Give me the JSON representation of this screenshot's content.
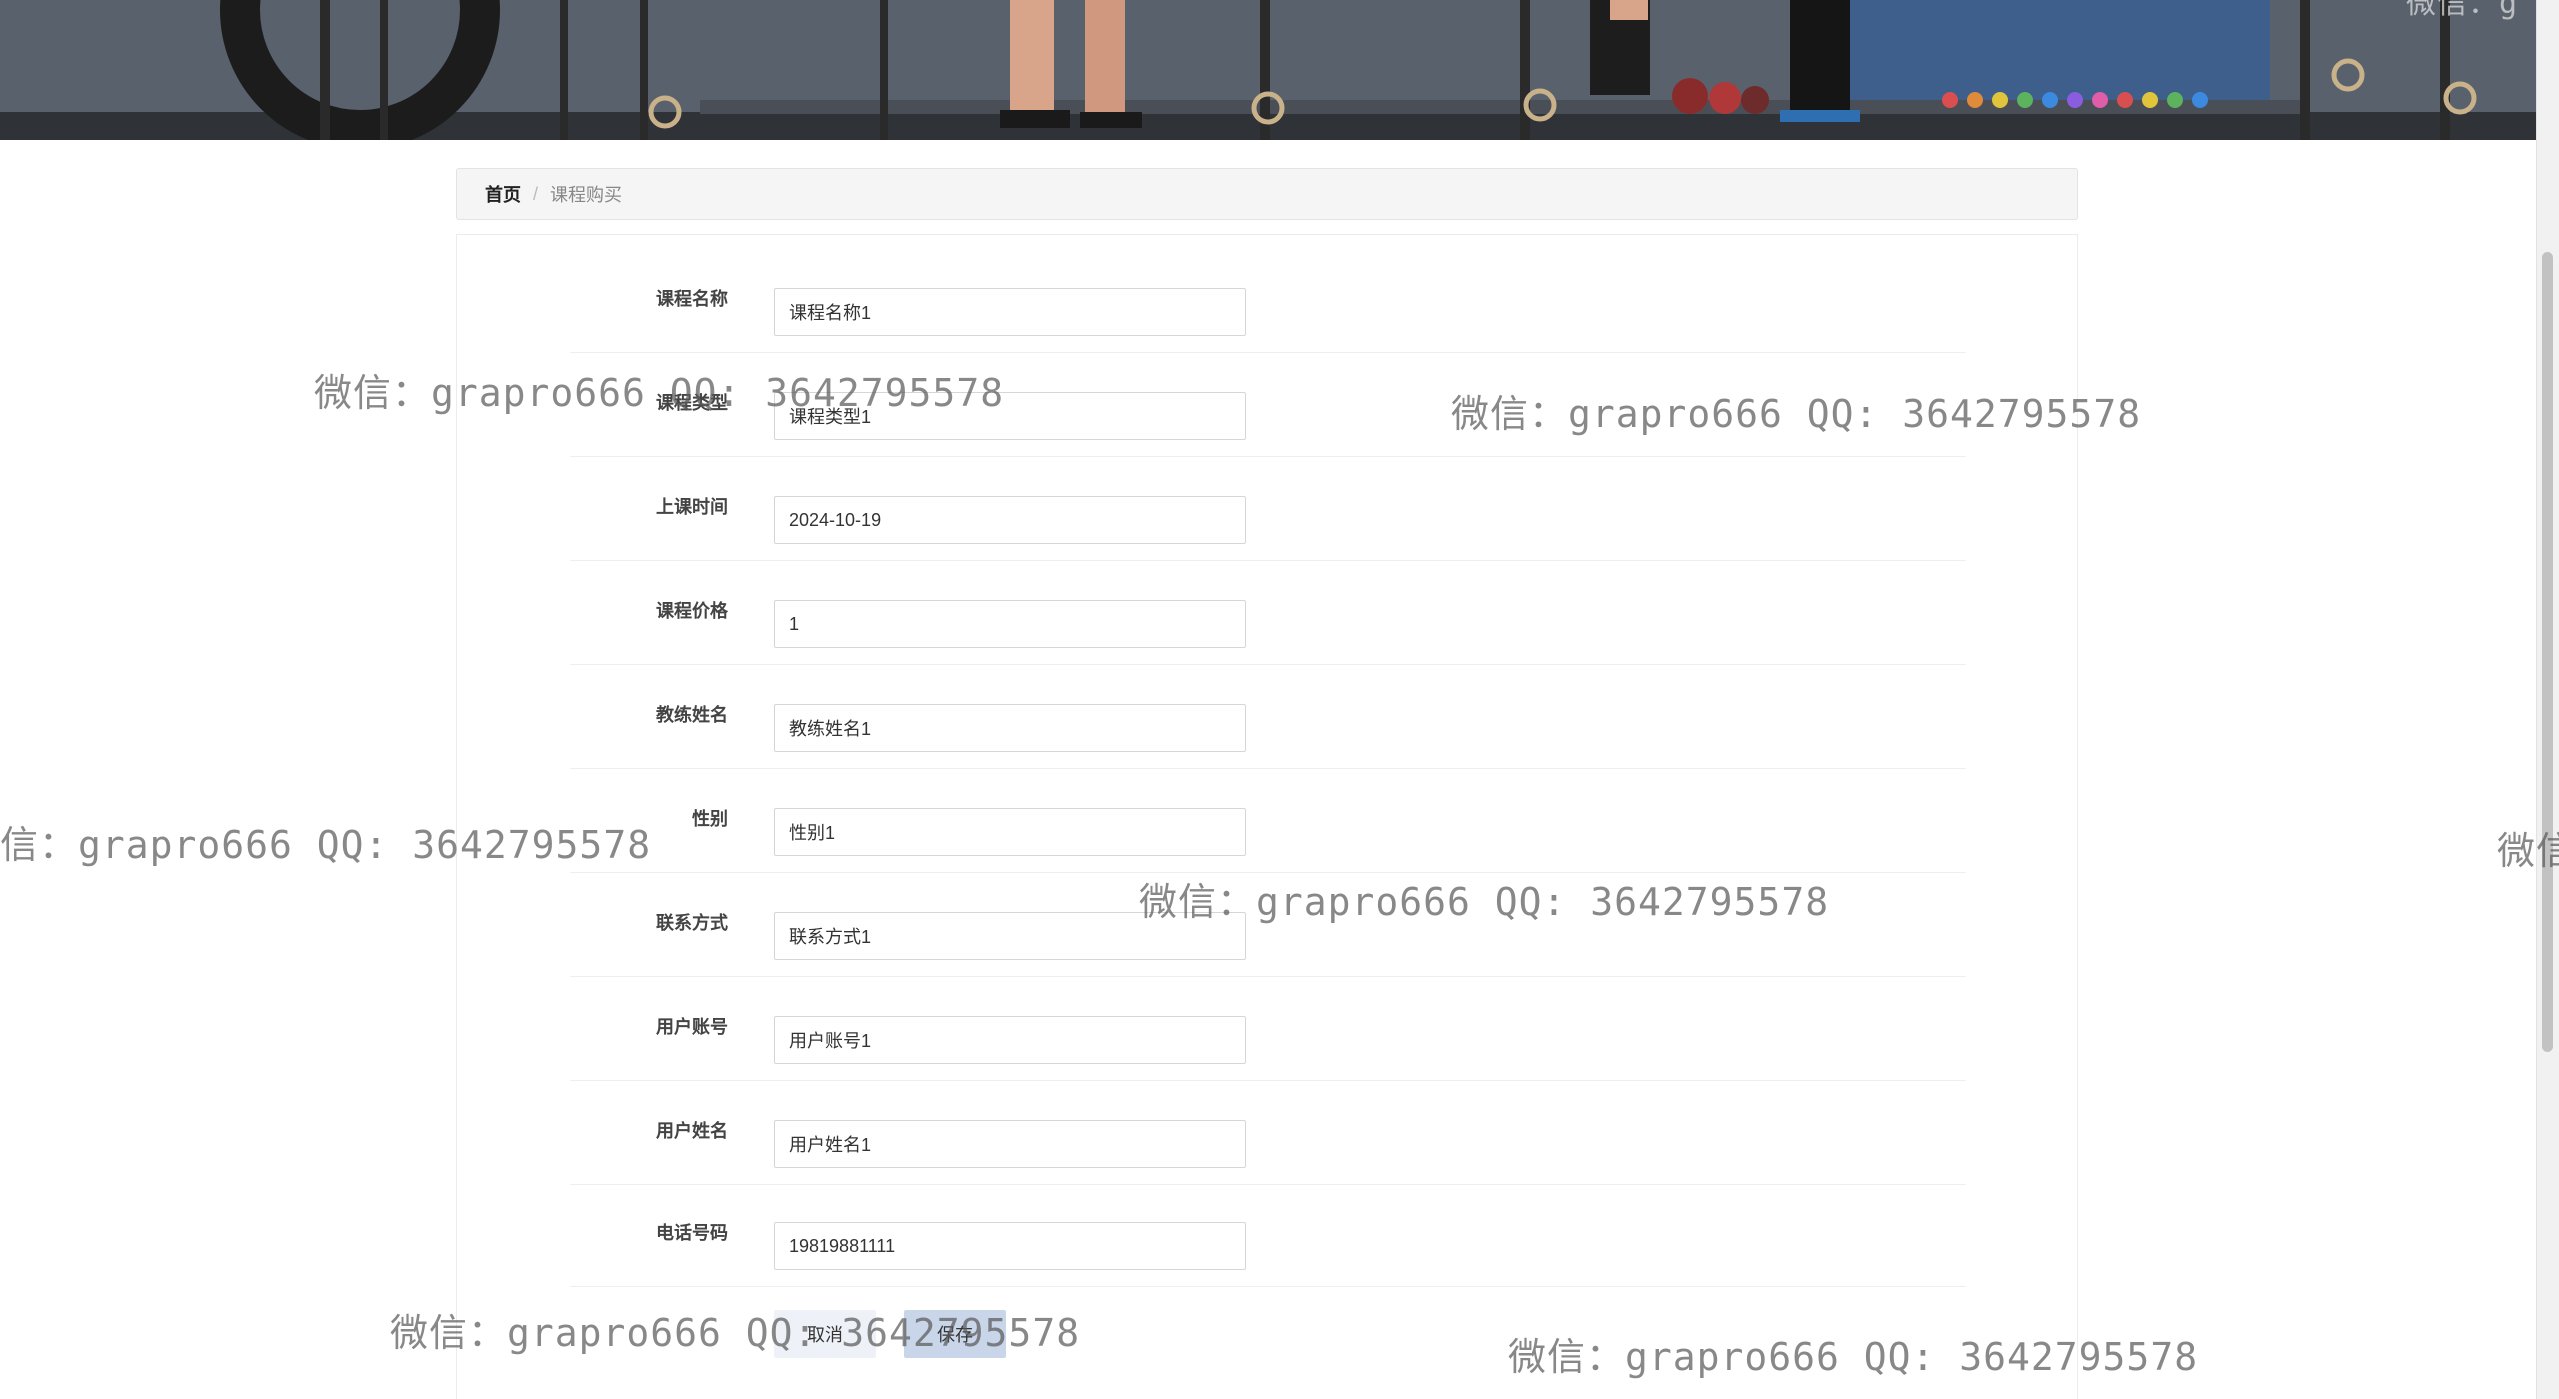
{
  "breadcrumb": {
    "home": "首页",
    "separator": "/",
    "current": "课程购买"
  },
  "form": {
    "fields": [
      {
        "label": "课程名称",
        "value": "课程名称1"
      },
      {
        "label": "课程类型",
        "value": "课程类型1"
      },
      {
        "label": "上课时间",
        "value": "2024-10-19"
      },
      {
        "label": "课程价格",
        "value": "1"
      },
      {
        "label": "教练姓名",
        "value": "教练姓名1"
      },
      {
        "label": "性别",
        "value": "性别1"
      },
      {
        "label": "联系方式",
        "value": "联系方式1"
      },
      {
        "label": "用户账号",
        "value": "用户账号1"
      },
      {
        "label": "用户姓名",
        "value": "用户姓名1"
      },
      {
        "label": "电话号码",
        "value": "19819881111"
      }
    ],
    "cancel_label": "取消",
    "save_label": "保存"
  },
  "watermark": {
    "text": "微信：grapro666 QQ: 3642795578",
    "partial_left": "信：grapro666 QQ: 3642795578",
    "partial_right": "微信",
    "partial_top": "微信：g"
  },
  "colors": {
    "save_button": "#c9d6ea",
    "cancel_button": "#eef1f7",
    "breadcrumb_bg": "#f5f5f5"
  }
}
